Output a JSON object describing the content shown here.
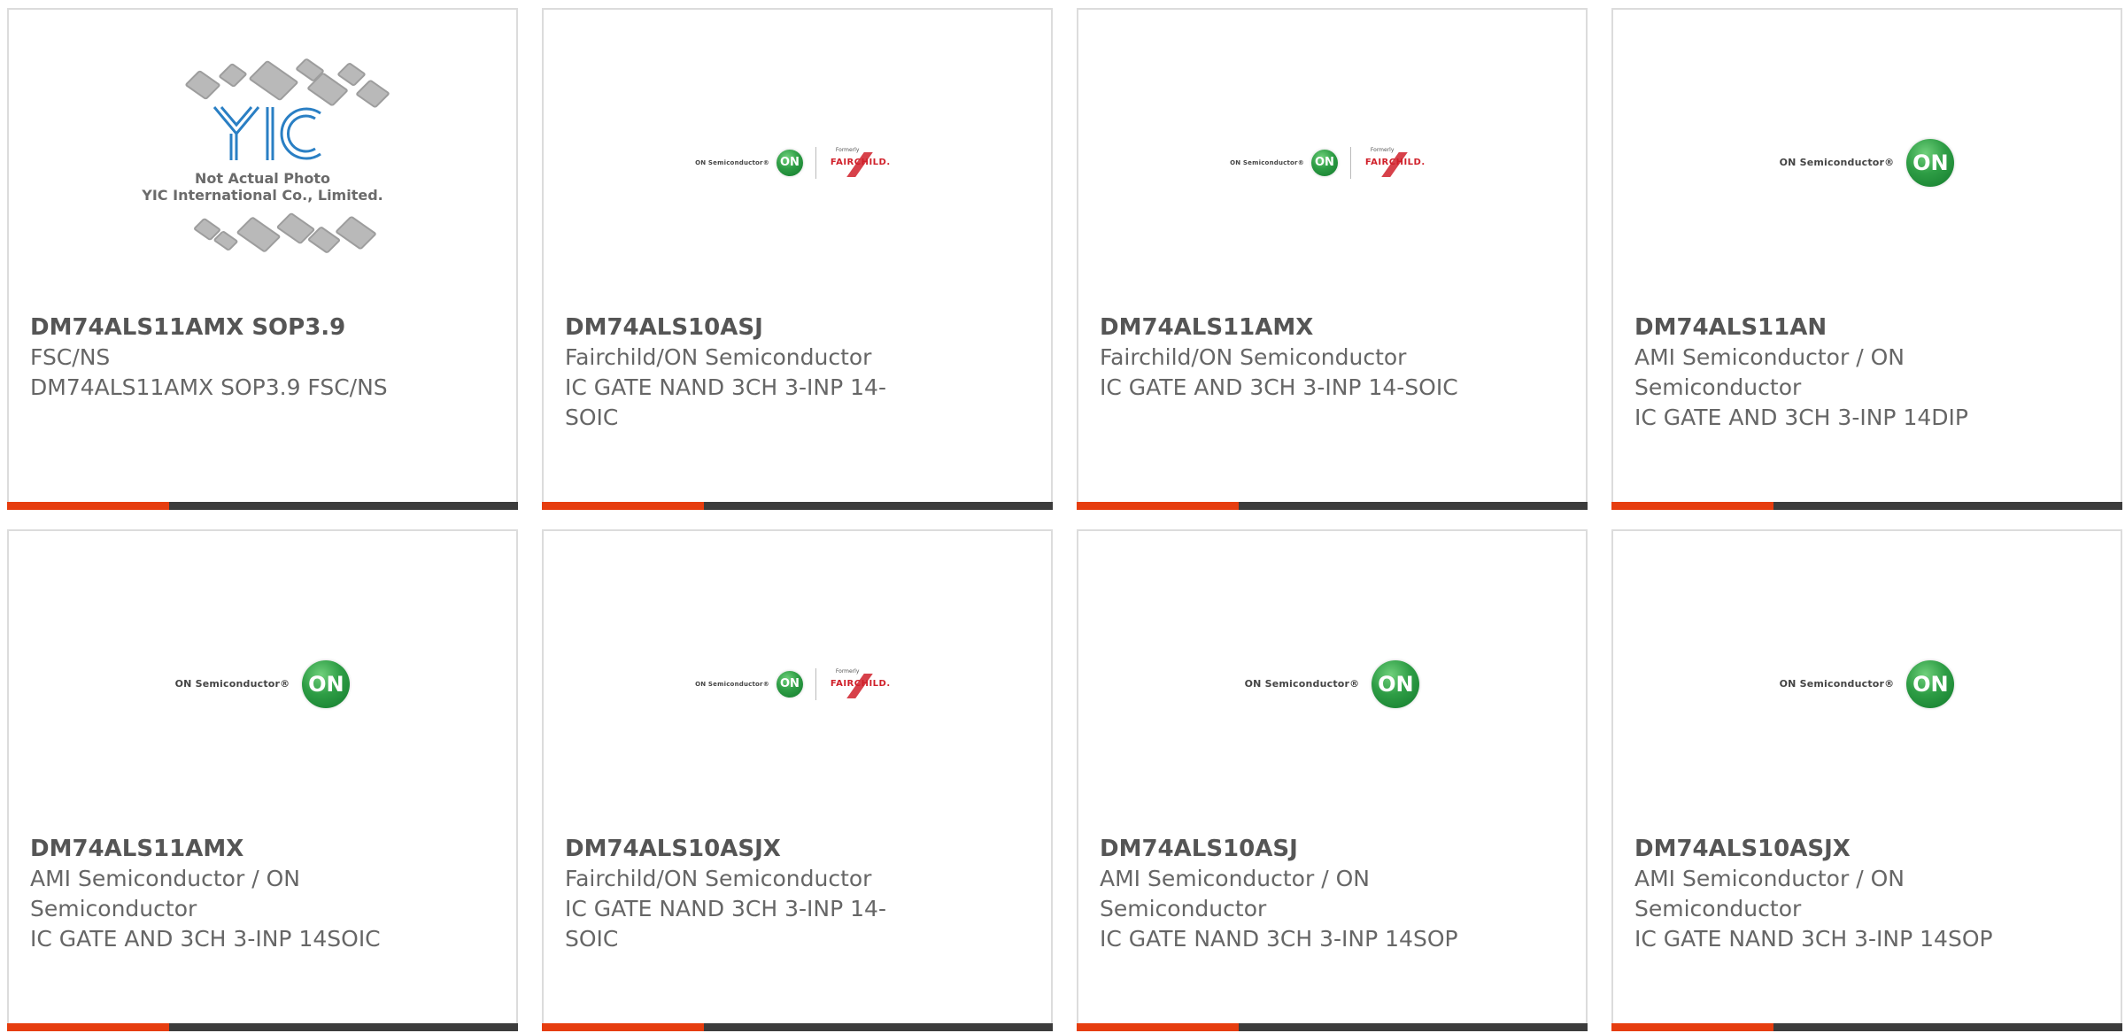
{
  "products": [
    {
      "part_number": "DM74ALS11AMX SOP3.9",
      "lines": [
        "FSC/NS",
        "DM74ALS11AMX SOP3.9 FSC/NS"
      ],
      "image": {
        "kind": "yic-placeholder",
        "note_line1": "Not Actual Photo",
        "note_line2": "YIC International Co., Limited."
      }
    },
    {
      "part_number": "DM74ALS10ASJ",
      "lines": [
        "Fairchild/ON Semiconductor",
        "IC GATE NAND 3CH 3-INP 14-",
        "SOIC"
      ],
      "image": {
        "kind": "on-fairchild-logo"
      }
    },
    {
      "part_number": "DM74ALS11AMX",
      "lines": [
        "Fairchild/ON Semiconductor",
        "IC GATE AND 3CH 3-INP 14-SOIC"
      ],
      "image": {
        "kind": "on-fairchild-logo"
      }
    },
    {
      "part_number": "DM74ALS11AN",
      "lines": [
        "AMI Semiconductor / ON",
        "Semiconductor",
        "IC GATE AND 3CH 3-INP 14DIP"
      ],
      "image": {
        "kind": "on-logo"
      }
    },
    {
      "part_number": "DM74ALS11AMX",
      "lines": [
        "AMI Semiconductor / ON",
        "Semiconductor",
        "IC GATE AND 3CH 3-INP 14SOIC"
      ],
      "image": {
        "kind": "on-logo"
      }
    },
    {
      "part_number": "DM74ALS10ASJX",
      "lines": [
        "Fairchild/ON Semiconductor",
        "IC GATE NAND 3CH 3-INP 14-",
        "SOIC"
      ],
      "image": {
        "kind": "on-fairchild-logo"
      }
    },
    {
      "part_number": "DM74ALS10ASJ",
      "lines": [
        "AMI Semiconductor / ON",
        "Semiconductor",
        "IC GATE NAND 3CH 3-INP 14SOP"
      ],
      "image": {
        "kind": "on-logo"
      }
    },
    {
      "part_number": "DM74ALS10ASJX",
      "lines": [
        "AMI Semiconductor / ON",
        "Semiconductor",
        "IC GATE NAND 3CH 3-INP 14SOP"
      ],
      "image": {
        "kind": "on-logo"
      }
    }
  ],
  "logos": {
    "on_semi_text": "ON Semiconductor®",
    "on_mark": "ON",
    "fairchild_formerly": "Formerly",
    "fairchild_name": "FAIRCHILD."
  },
  "colors": {
    "accent": "#e63d0f",
    "bar": "#3c3c3c",
    "text": "#666666",
    "border": "#dcdcdc"
  }
}
